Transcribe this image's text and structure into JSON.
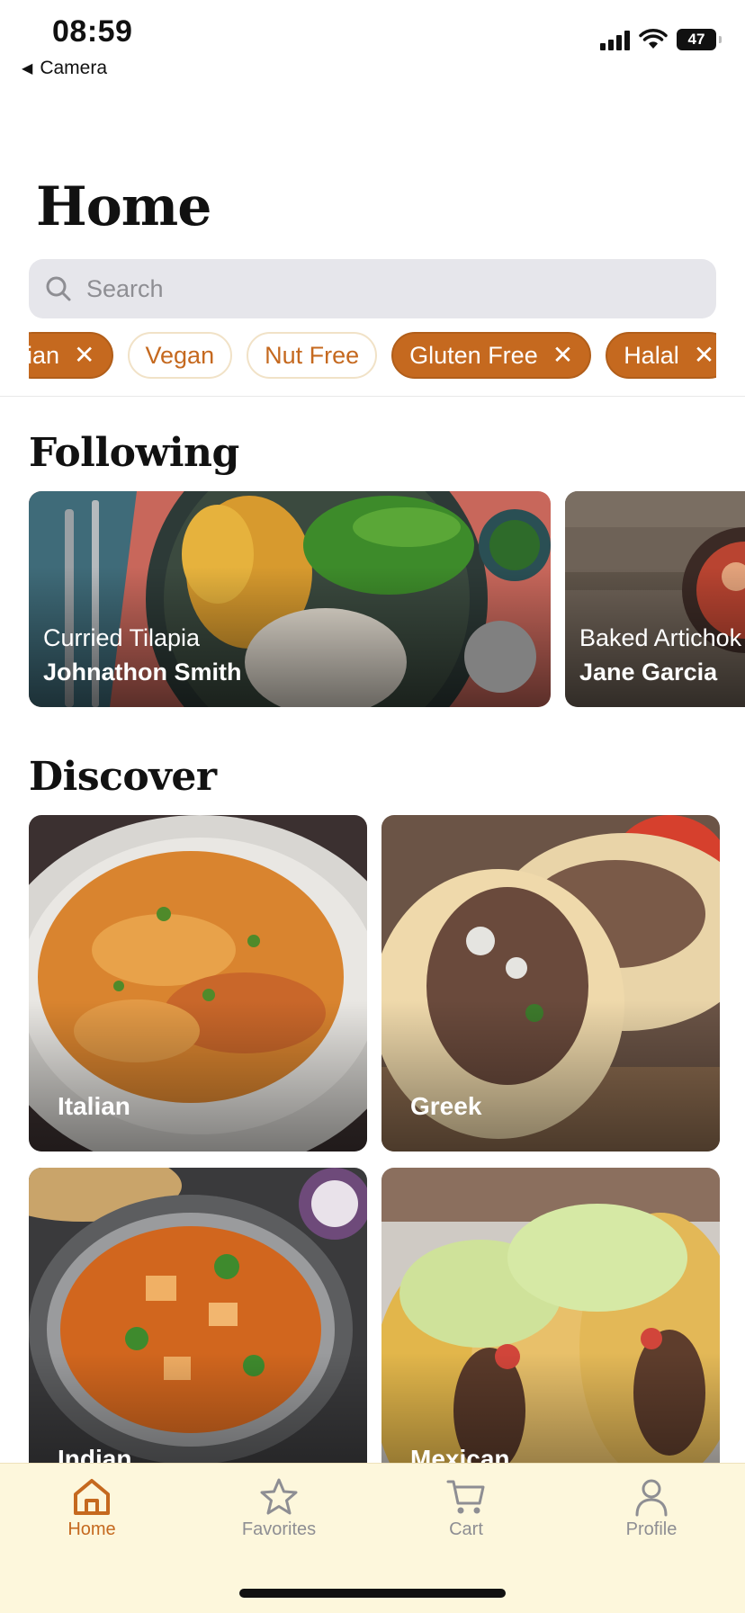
{
  "status_bar": {
    "time": "08:59",
    "back_app": "Camera",
    "battery": "47"
  },
  "header": {
    "title": "Home"
  },
  "search": {
    "placeholder": "Search"
  },
  "filters": [
    {
      "label": "ian",
      "active": true
    },
    {
      "label": "Vegan",
      "active": false
    },
    {
      "label": "Nut Free",
      "active": false
    },
    {
      "label": "Gluten Free",
      "active": true
    },
    {
      "label": "Halal",
      "active": true
    }
  ],
  "following": {
    "title": "Following",
    "cards": [
      {
        "dish": "Curried Tilapia",
        "author": "Johnathon Smith"
      },
      {
        "dish": "Baked Artichok",
        "author": "Jane Garcia"
      }
    ]
  },
  "discover": {
    "title": "Discover",
    "tiles": [
      {
        "label": "Italian"
      },
      {
        "label": "Greek"
      },
      {
        "label": "Indian"
      },
      {
        "label": "Mexican"
      }
    ]
  },
  "tab_bar": {
    "items": [
      {
        "label": "Home",
        "icon": "home-icon",
        "active": true
      },
      {
        "label": "Favorites",
        "icon": "star-icon",
        "active": false
      },
      {
        "label": "Cart",
        "icon": "cart-icon",
        "active": false
      },
      {
        "label": "Profile",
        "icon": "person-icon",
        "active": false
      }
    ]
  },
  "colors": {
    "accent": "#c5691f",
    "chip_border": "#f1e2c7",
    "tab_bar_bg": "#fdf7dc",
    "search_bg": "#e6e6eb"
  }
}
